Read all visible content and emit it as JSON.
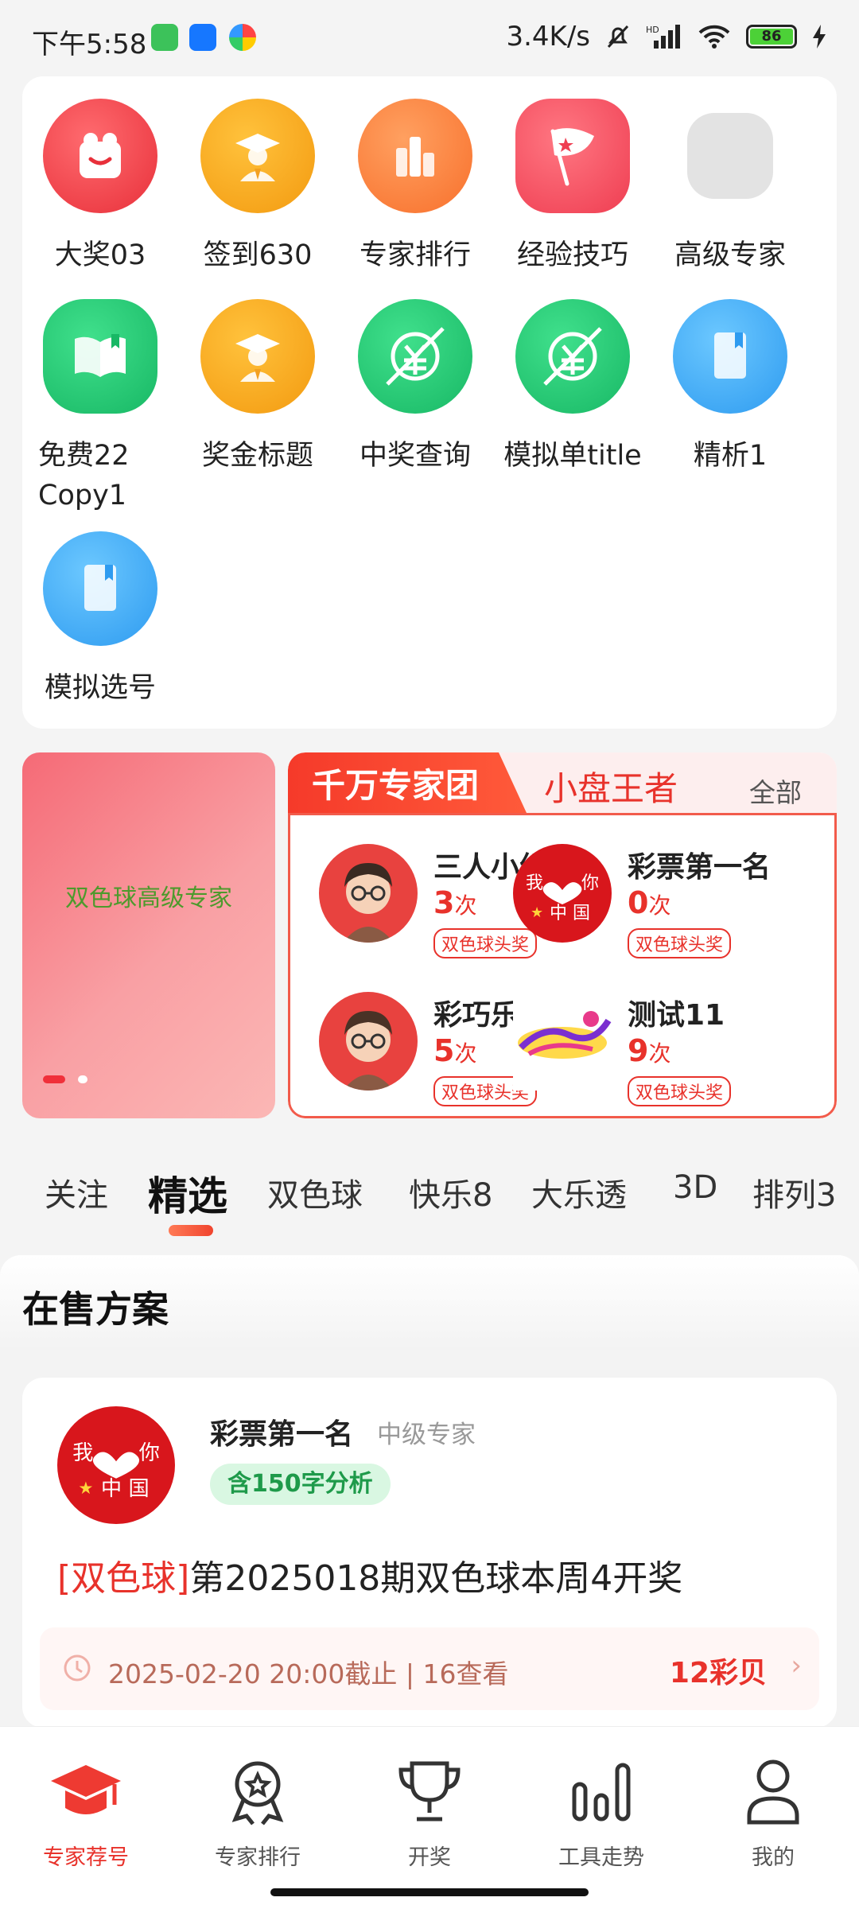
{
  "status_bar": {
    "time": "下午5:58",
    "network_speed": "3.4K/s",
    "battery": "86"
  },
  "grid": {
    "items": [
      {
        "label": "大奖03",
        "icon": "gift-icon",
        "color": "#f0434a"
      },
      {
        "label": "签到630",
        "icon": "graduate-icon",
        "color": "#f7a91a"
      },
      {
        "label": "专家排行",
        "icon": "bar-chart-icon",
        "color": "#fb7a34"
      },
      {
        "label": "经验技巧",
        "icon": "flag-icon",
        "color": "#f25060"
      },
      {
        "label": "高级专家",
        "icon": "placeholder-icon",
        "color": "#e3e3e3"
      },
      {
        "label": "免费22 Copy1",
        "icon": "open-book-icon",
        "color": "#22c673"
      },
      {
        "label": "奖金标题",
        "icon": "graduate-icon",
        "color": "#f7a91a"
      },
      {
        "label": "中奖查询",
        "icon": "currency-slash-icon",
        "color": "#22c673"
      },
      {
        "label": "模拟单title",
        "icon": "currency-slash-icon",
        "color": "#22c673"
      },
      {
        "label": "精析1",
        "icon": "book-icon",
        "color": "#3aaaf0"
      },
      {
        "label": "模拟选号",
        "icon": "book-icon",
        "color": "#3aaaf0"
      }
    ]
  },
  "banner": {
    "text": "双色球高级专家"
  },
  "expert_panel": {
    "tab_active": "千万专家团",
    "tab_other": "小盘王者",
    "all_label": "全部",
    "times_unit": "次",
    "experts": [
      {
        "name": "三人小组",
        "count": "3",
        "tag": "双色球头奖",
        "avatar": "cartoon-man-avatar"
      },
      {
        "name": "彩票第一名",
        "count": "0",
        "tag": "双色球头奖",
        "avatar": "love-china-avatar"
      },
      {
        "name": "彩巧乐",
        "count": "5",
        "tag": "双色球头奖",
        "avatar": "cartoon-man-avatar"
      },
      {
        "name": "测试11",
        "count": "9",
        "tag": "双色球头奖",
        "avatar": "logo-avatar"
      }
    ]
  },
  "lottery_tabs": [
    "关注",
    "精选",
    "双色球",
    "快乐8",
    "大乐透",
    "3D",
    "排列3"
  ],
  "active_tab": "精选",
  "sale_section": {
    "title": "在售方案"
  },
  "plan": {
    "author": "彩票第一名",
    "level": "中级专家",
    "badge": "含150字分析",
    "title_tag": "[双色球]",
    "title_text": "第2025018期双色球本周4开奖",
    "meta": "2025-02-20 20:00截止 | 16查看",
    "price": "12彩贝",
    "avatar_text_top": "我爱你",
    "avatar_text_bottom": "中国"
  },
  "bottom_nav": [
    {
      "label": "专家荐号",
      "icon": "graduation-cap-icon",
      "active": true
    },
    {
      "label": "专家排行",
      "icon": "award-medal-icon",
      "active": false
    },
    {
      "label": "开奖",
      "icon": "trophy-icon",
      "active": false
    },
    {
      "label": "工具走势",
      "icon": "trend-bars-icon",
      "active": false
    },
    {
      "label": "我的",
      "icon": "user-icon",
      "active": false
    }
  ],
  "colors": {
    "accent": "#e8322b",
    "green_badge": "#1e9a4a"
  }
}
